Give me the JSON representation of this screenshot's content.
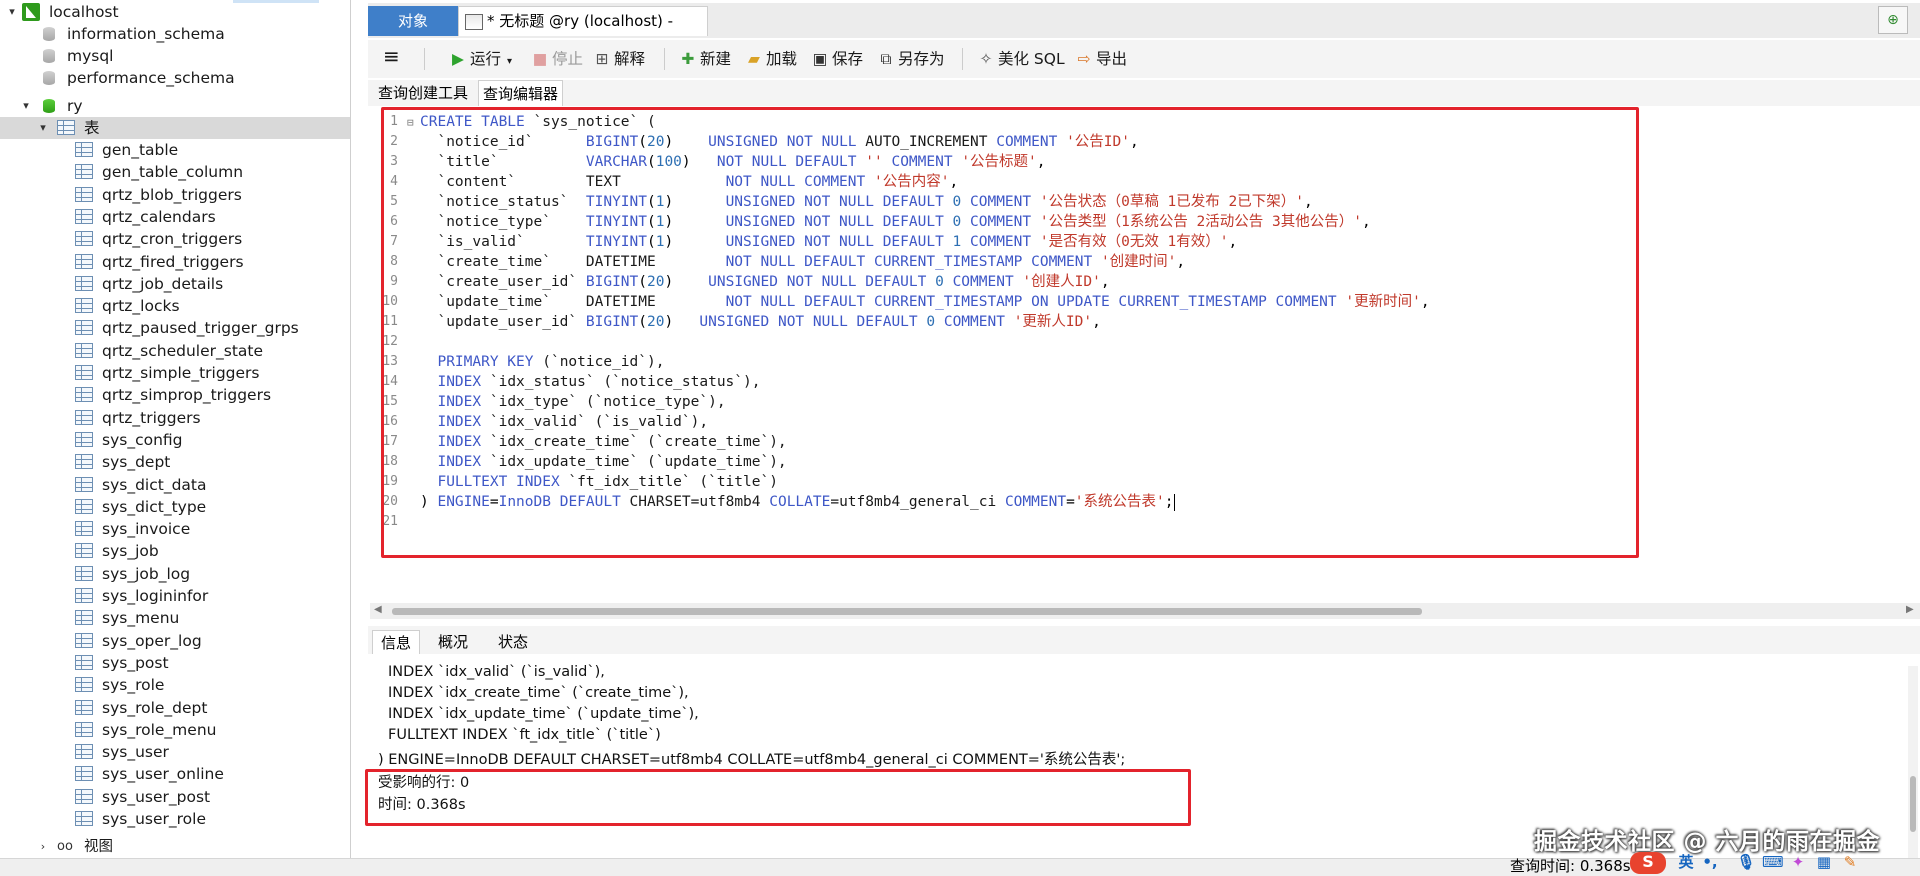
{
  "tree": {
    "connection": "localhost",
    "databases": [
      "information_schema",
      "mysql",
      "performance_schema"
    ],
    "active_db": "ry",
    "tables_folder": "表",
    "tables": [
      "gen_table",
      "gen_table_column",
      "qrtz_blob_triggers",
      "qrtz_calendars",
      "qrtz_cron_triggers",
      "qrtz_fired_triggers",
      "qrtz_job_details",
      "qrtz_locks",
      "qrtz_paused_trigger_grps",
      "qrtz_scheduler_state",
      "qrtz_simple_triggers",
      "qrtz_simprop_triggers",
      "qrtz_triggers",
      "sys_config",
      "sys_dept",
      "sys_dict_data",
      "sys_dict_type",
      "sys_invoice",
      "sys_job",
      "sys_job_log",
      "sys_logininfor",
      "sys_menu",
      "sys_oper_log",
      "sys_post",
      "sys_role",
      "sys_role_dept",
      "sys_role_menu",
      "sys_user",
      "sys_user_online",
      "sys_user_post",
      "sys_user_role"
    ],
    "views_folder": "视图"
  },
  "tabs": {
    "objects": "对象",
    "query": "* 无标题 @ry (localhost) - 查..."
  },
  "toolbar": {
    "menu": "≡",
    "run": "运行",
    "stop": "停止",
    "explain": "解释",
    "new": "新建",
    "load": "加载",
    "save": "保存",
    "save_as": "另存为",
    "beautify": "美化 SQL",
    "export": "导出"
  },
  "subtabs": {
    "builder": "查询创建工具",
    "editor": "查询编辑器"
  },
  "bottom_tabs": {
    "info": "信息",
    "profile": "概况",
    "status": "状态"
  },
  "info_lines": [
    "INDEX `idx_valid` (`is_valid`),",
    "INDEX `idx_create_time` (`create_time`),",
    "INDEX `idx_update_time` (`update_time`),",
    "FULLTEXT INDEX `ft_idx_title` (`title`)",
    ") ENGINE=InnoDB DEFAULT CHARSET=utf8mb4 COLLATE=utf8mb4_general_ci COMMENT='系统公告表';"
  ],
  "result": {
    "affected": "受影响的行: 0",
    "time": "时间: 0.368s"
  },
  "status_bar": {
    "query_time": "查询时间: 0.368s"
  },
  "watermark": "掘金技术社区 @ 六月的雨在掘金",
  "ime": {
    "lang": "英"
  },
  "colors": {
    "accent": "#3f7fc9",
    "highlight_box": "#e3232c",
    "keyword": "#3e57c7",
    "string": "#c0392b"
  }
}
